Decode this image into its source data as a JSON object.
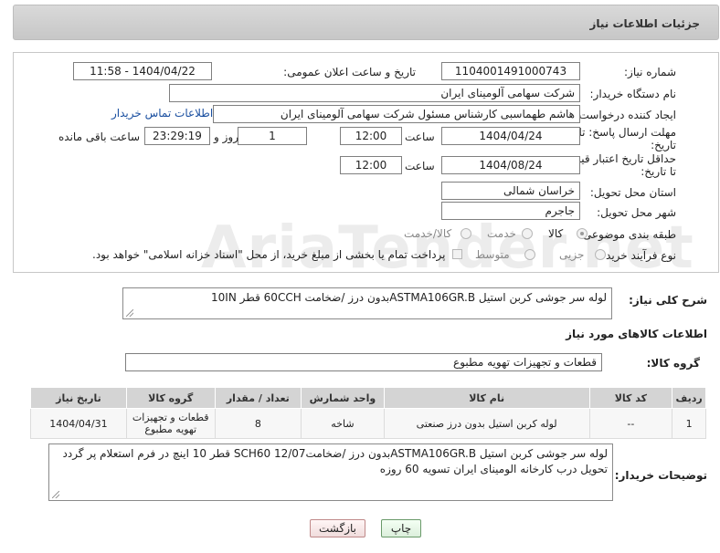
{
  "header": {
    "title": "جزئیات اطلاعات نیاز"
  },
  "form": {
    "need_number_label": "شماره نیاز:",
    "need_number": "1104001491000743",
    "announce_label": "تاریخ و ساعت اعلان عمومی:",
    "announce_value": "1404/04/22 - 11:58",
    "buyer_org_label": "نام دستگاه خریدار:",
    "buyer_org": "شرکت سهامی آلومینای ایران",
    "requester_label": "ایجاد کننده درخواست:",
    "requester": "هاشم طهماسبی کارشناس مسئول شرکت سهامی آلومینای ایران",
    "contact_link": "اطلاعات تماس خریدار",
    "reply_deadline_label_1": "مهلت ارسال پاسخ: تا",
    "reply_deadline_label_2": "تاریخ:",
    "reply_date": "1404/04/24",
    "time_label": "ساعت",
    "reply_time": "12:00",
    "days_value": "1",
    "days_label": "روز و",
    "remaining_time": "23:29:19",
    "remaining_label": "ساعت باقی مانده",
    "price_deadline_label_1": "حداقل تاریخ اعتبار قیمت:",
    "price_deadline_label_2": "تا تاریخ:",
    "price_date": "1404/08/24",
    "price_time": "12:00",
    "province_label": "استان محل تحویل:",
    "province": "خراسان شمالی",
    "city_label": "شهر محل تحویل:",
    "city": "جاجرم",
    "category_label": "طبقه بندی موضوعی:",
    "category_options": [
      "کالا",
      "خدمت",
      "کالا/خدمت"
    ],
    "category_selected": "کالا",
    "process_label": "نوع فرآیند خرید :",
    "process_options": [
      "جزیی",
      "متوسط"
    ],
    "payment_note": "پرداخت تمام یا بخشی از مبلغ خرید، از محل \"اسناد خزانه اسلامی\" خواهد بود."
  },
  "description": {
    "label": "شرح کلی نیاز:",
    "value": "لوله سر جوشی کربن استیل ASTMA106GR.Bبدون درز /ضخامت 60CCH قطر 10IN"
  },
  "goods": {
    "section_title": "اطلاعات کالاهای مورد نیاز",
    "group_label": "گروه کالا:",
    "group_value": "قطعات و تجهیزات تهویه مطبوع",
    "columns": [
      "ردیف",
      "کد کالا",
      "نام کالا",
      "واحد شمارش",
      "تعداد / مقدار",
      "گروه کالا",
      "تاریخ نیاز"
    ],
    "rows": [
      {
        "index": "1",
        "code": "--",
        "name": "لوله کربن استیل بدون درز صنعتی",
        "unit": "شاخه",
        "qty": "8",
        "group": "قطعات و تجهیزات تهویه مطبوع",
        "date": "1404/04/31"
      }
    ]
  },
  "buyer_notes": {
    "label": "توضیحات خریدار:",
    "value": "لوله سر جوشی کربن استیل ASTMA106GR.Bبدون درز /ضخامتSCH60 12/07  قطر 10 اینچ در فرم استعلام پر گردد تحویل درب کارخانه الومینای ایران تسویه 60 روزه"
  },
  "buttons": {
    "print": "چاپ",
    "back": "بازگشت"
  },
  "watermark": "AriaTender.net",
  "colors": {
    "link": "#1a4fa0",
    "header_bg": "#d0d0d0",
    "table_header": "#d4d4d4"
  }
}
